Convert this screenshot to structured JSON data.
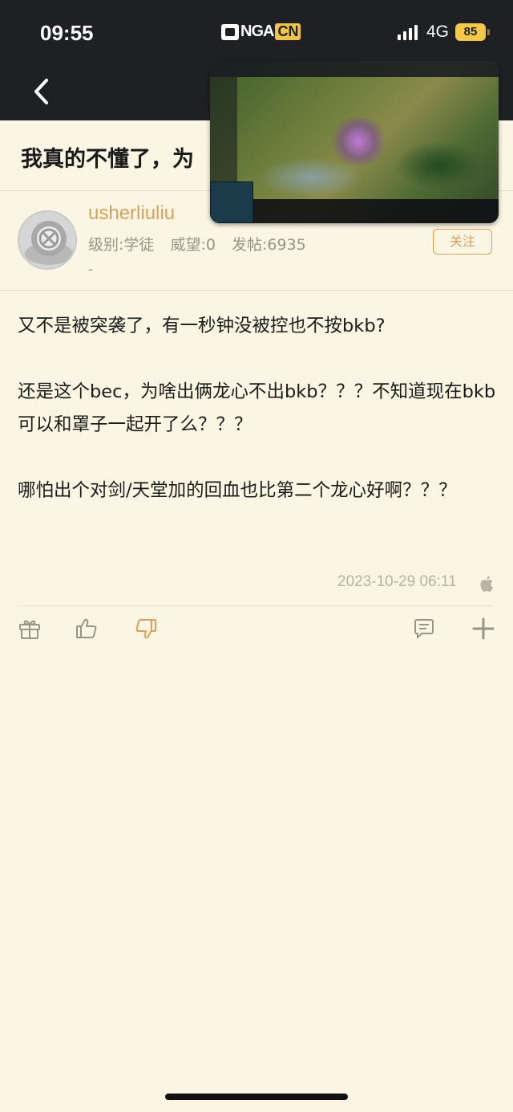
{
  "status_bar": {
    "time": "09:55",
    "app_logo": {
      "left": "NGA",
      "right": "CN"
    },
    "network": "4G",
    "battery": "85"
  },
  "nav": {
    "back_icon": "chevron-left-icon",
    "title": "我真的不懂了，为"
  },
  "author": {
    "username": "usherliuliu",
    "level": "级别:学徒",
    "reputation": "威望:0",
    "posts": "发帖:6935",
    "signature": "-",
    "follow_label": "关注"
  },
  "post": {
    "paragraphs": [
      "又不是被突袭了，有一秒钟没被控也不按bkb?",
      "还是这个bec，为啥出俩龙心不出bkb？？？不知道现在bkb可以和罩子一起开了么？？？",
      "哪怕出个对剑/天堂加的回血也比第二个龙心好啊？？？"
    ],
    "timestamp": "2023-10-29 06:11",
    "platform_icon": "apple-icon"
  },
  "actions": {
    "left": [
      "gift-icon",
      "thumbs-up-icon",
      "thumbs-down-icon"
    ],
    "right": [
      "comment-icon",
      "plus-icon"
    ]
  },
  "colors": {
    "background": "#fbf6e3",
    "header": "#1f2024",
    "accent": "#d9a05a",
    "muted": "#9a9488",
    "battery": "#f3c84a"
  }
}
